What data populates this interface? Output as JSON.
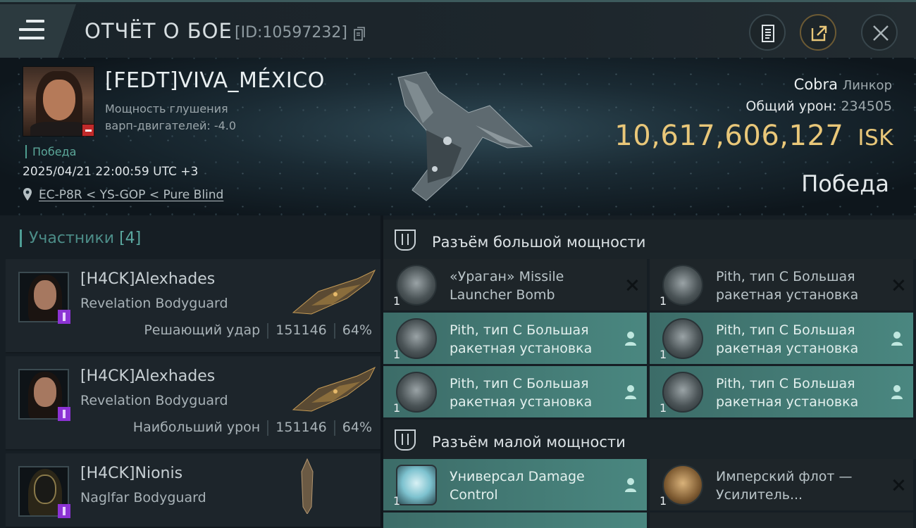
{
  "header": {
    "title": "ОТЧЁТ О БОЕ",
    "report_id": "[ID:10597232]",
    "icons": [
      "menu-icon",
      "copy-icon",
      "clipboard-icon",
      "share-icon",
      "close-icon"
    ]
  },
  "victim": {
    "name": "[FEDT]VIVA_MÉXICO",
    "warp_line1": "Мощность глушения",
    "warp_line2": "варп-двигателей: -4.0",
    "status": "Победа",
    "datetime": "2025/04/21 22:00:59 UTC +3",
    "location": "EC-P8R < YS-GOP < Pure Blind",
    "ship_name": "Cobra",
    "ship_class": "Линкор",
    "damage_label": "Общий урон:",
    "damage_value": "234505",
    "isk_value": "10,617,606,127",
    "isk_unit": "ISK",
    "result": "Победа"
  },
  "participants": {
    "title": "Участники",
    "count": "[4]",
    "items": [
      {
        "name": "[H4CK]Alexhades",
        "ship": "Revelation Bodyguard",
        "role": "Решающий удар",
        "damage": "151146",
        "percent": "64%"
      },
      {
        "name": "[H4CK]Alexhades",
        "ship": "Revelation Bodyguard",
        "role": "Наибольший урон",
        "damage": "151146",
        "percent": "64%"
      },
      {
        "name": "[H4CK]Nionis",
        "ship": "Naglfar Bodyguard"
      }
    ]
  },
  "slots": {
    "high": {
      "title": "Разъём большой мощности",
      "modules": [
        {
          "line1": "«Ураган» Missile",
          "line2": "Launcher Bomb",
          "qty": "1",
          "state": "destroyed"
        },
        {
          "line1": "Pith, тип C Большая",
          "line2": "ракетная установка",
          "qty": "1",
          "state": "destroyed"
        },
        {
          "line1": "Pith, тип C Большая",
          "line2": "ракетная установка",
          "qty": "1",
          "state": "dropped"
        },
        {
          "line1": "Pith, тип C Большая",
          "line2": "ракетная установка",
          "qty": "1",
          "state": "dropped"
        },
        {
          "line1": "Pith, тип C Большая",
          "line2": "ракетная установка",
          "qty": "1",
          "state": "dropped"
        },
        {
          "line1": "Pith, тип C Большая",
          "line2": "ракетная установка",
          "qty": "1",
          "state": "dropped"
        }
      ]
    },
    "low": {
      "title": "Разъём малой мощности",
      "modules": [
        {
          "line1": "Универсал Damage",
          "line2": "Control",
          "qty": "1",
          "state": "dropped"
        },
        {
          "line1": "Имперский флот —",
          "line2": "Усилитель...",
          "qty": "1",
          "state": "destroyed"
        }
      ]
    }
  },
  "colors": {
    "accent_teal": "#4a8780",
    "isk_gold": "#e9c779",
    "victory_green": "#5ca89a",
    "badge_red": "#c12a2a",
    "badge_purple": "#8c33d4"
  }
}
